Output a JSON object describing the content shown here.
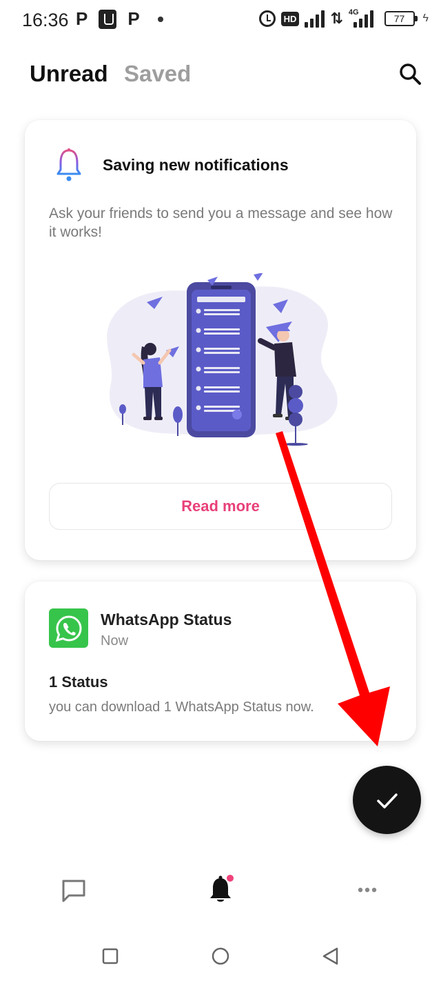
{
  "status_bar": {
    "time": "16:36",
    "left_icons": [
      "p-icon",
      "usb-icon",
      "p-icon",
      "dot"
    ],
    "right_icons": [
      "alarm-icon",
      "hd-icon",
      "signal-icon",
      "data-arrows-icon",
      "signal-4g-icon",
      "battery-icon",
      "charging-icon"
    ],
    "hd_label": "HD",
    "net_label": "4G",
    "battery_level": "77",
    "p_glyph": "P"
  },
  "header": {
    "tabs": [
      {
        "label": "Unread",
        "active": true
      },
      {
        "label": "Saved",
        "active": false
      }
    ],
    "search_icon": "search-icon"
  },
  "info_card": {
    "icon": "bell-icon",
    "title": "Saving new notifications",
    "body": "Ask your friends to send you a message and see how it works!",
    "illustration": "people-sending-messages-illustration",
    "button_label": "Read more",
    "accent": "#e8407a"
  },
  "notification": {
    "app_icon": "whatsapp-icon",
    "app_name": "WhatsApp Status",
    "time": "Now",
    "headline": "1 Status",
    "body": "you can download 1 WhatsApp Status now."
  },
  "fab": {
    "icon": "check-icon",
    "color": "#141414"
  },
  "annotation": {
    "icon": "red-arrow",
    "color": "#ff0000"
  },
  "bottom_nav": {
    "items": [
      {
        "name": "chat",
        "icon": "chat-icon",
        "active": false
      },
      {
        "name": "notifications",
        "icon": "bell-icon",
        "active": true,
        "badge": true
      },
      {
        "name": "more",
        "icon": "more-icon",
        "active": false
      }
    ],
    "badge_color": "#f0427a"
  },
  "system_nav": {
    "buttons": [
      "recent-apps",
      "home",
      "back"
    ]
  }
}
